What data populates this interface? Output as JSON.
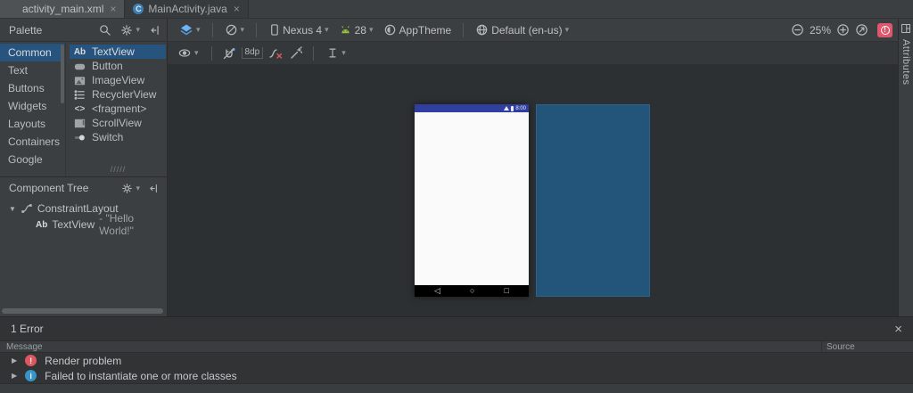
{
  "editor_tabs": [
    {
      "label": "activity_main.xml",
      "active": true
    },
    {
      "label": "MainActivity.java",
      "active": false
    }
  ],
  "icons": {
    "caret_down": "▾",
    "expand_right": "▶",
    "expand_down": "▼",
    "close": "×",
    "nav_back": "◁",
    "nav_home": "○",
    "nav_recents": "□",
    "ab_glyph": "Ab",
    "fragment_glyph": "<>",
    "class_glyph": "C",
    "hatch": "/////"
  },
  "toolbar": {
    "device": "Nexus 4",
    "api": "28",
    "theme": "AppTheme",
    "locale": "Default (en-us)",
    "zoom": "25%"
  },
  "design_toolbar": {
    "default_margin": "8dp"
  },
  "palette": {
    "title": "Palette",
    "categories": [
      "Common",
      "Text",
      "Buttons",
      "Widgets",
      "Layouts",
      "Containers",
      "Google"
    ],
    "selected_category": "Common",
    "components": [
      "TextView",
      "Button",
      "ImageView",
      "RecyclerView",
      "<fragment>",
      "ScrollView",
      "Switch"
    ],
    "selected_component": "TextView"
  },
  "component_tree": {
    "title": "Component Tree",
    "nodes": [
      {
        "label": "ConstraintLayout"
      },
      {
        "label": "TextView",
        "detail": "- \"Hello World!\""
      }
    ]
  },
  "right_panel": {
    "tab": "Attributes"
  },
  "device_screen": {
    "time": "8:00"
  },
  "error_panel": {
    "title": "1 Error",
    "columns": [
      "Message",
      "Source"
    ],
    "rows": [
      {
        "severity": "error",
        "message": "Render problem"
      },
      {
        "severity": "info",
        "message": "Failed to instantiate one or more classes"
      }
    ]
  },
  "colors": {
    "selection": "#27547e",
    "error_red": "#db5860",
    "info_blue": "#3794c8",
    "status_bar": "#303f9f",
    "blueprint": "#235479",
    "android_green": "#9ec43c",
    "layers_blue": "#4f9ce8",
    "error_badge": "#e0566c"
  }
}
